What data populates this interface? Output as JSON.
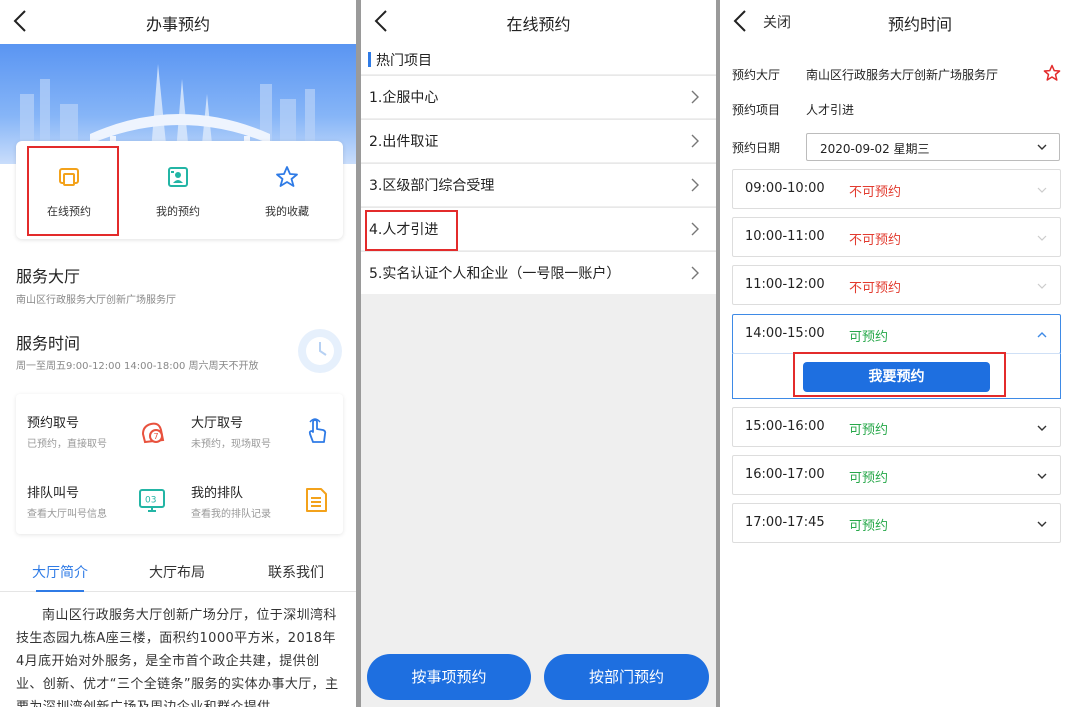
{
  "colors": {
    "accent": "#1e6fe0",
    "highlight_box": "#e32b2b",
    "unavailable": "#e23b2f",
    "available": "#27a84a"
  },
  "panel1": {
    "title": "办事预约",
    "quick": [
      {
        "label": "在线预约",
        "icon": "online-booking-icon"
      },
      {
        "label": "我的预约",
        "icon": "my-booking-icon"
      },
      {
        "label": "我的收藏",
        "icon": "star-icon"
      }
    ],
    "hall": {
      "title": "服务大厅",
      "subtitle": "南山区行政服务大厅创新广场服务厅"
    },
    "hours": {
      "title": "服务时间",
      "subtitle": "周一至周五9:00-12:00 14:00-18:00 周六周天不开放"
    },
    "services": [
      {
        "title": "预约取号",
        "sub": "已预约，直接取号",
        "icon": "booking-ticket-icon"
      },
      {
        "title": "大厅取号",
        "sub": "未预约，现场取号",
        "icon": "tap-hand-icon"
      },
      {
        "title": "排队叫号",
        "sub": "查看大厅叫号信息",
        "icon": "queue-screen-icon"
      },
      {
        "title": "我的排队",
        "sub": "查看我的排队记录",
        "icon": "queue-record-icon"
      }
    ],
    "tabs": [
      "大厅简介",
      "大厅布局",
      "联系我们"
    ],
    "intro": "南山区行政服务大厅创新广场分厅，位于深圳湾科技生态园九栋A座三楼，面积约1000平方米，2018年4月底开始对外服务，是全市首个政企共建，提供创业、创新、优才“三个全链条”服务的实体办事大厅，主要为深圳湾创新广场及周边企业和群众提供"
  },
  "panel2": {
    "title": "在线预约",
    "section": "热门项目",
    "items": [
      "1.企服中心",
      "2.出件取证",
      "3.区级部门综合受理",
      "4.人才引进",
      "5.实名认证个人和企业（一号限一账户）"
    ],
    "buttons": [
      "按事项预约",
      "按部门预约"
    ]
  },
  "panel3": {
    "close": "关闭",
    "title": "预约时间",
    "hall_label": "预约大厅",
    "hall_value": "南山区行政服务大厅创新广场服务厅",
    "item_label": "预约项目",
    "item_value": "人才引进",
    "date_label": "预约日期",
    "date_value": "2020-09-02  星期三",
    "slots": [
      {
        "time": "09:00-10:00",
        "status": "不可预约"
      },
      {
        "time": "10:00-11:00",
        "status": "不可预约"
      },
      {
        "time": "11:00-12:00",
        "status": "不可预约"
      },
      {
        "time": "14:00-15:00",
        "status": "可预约"
      },
      {
        "time": "15:00-16:00",
        "status": "可预约"
      },
      {
        "time": "16:00-17:00",
        "status": "可预约"
      },
      {
        "time": "17:00-17:45",
        "status": "可预约"
      }
    ],
    "book_button": "我要预约"
  }
}
